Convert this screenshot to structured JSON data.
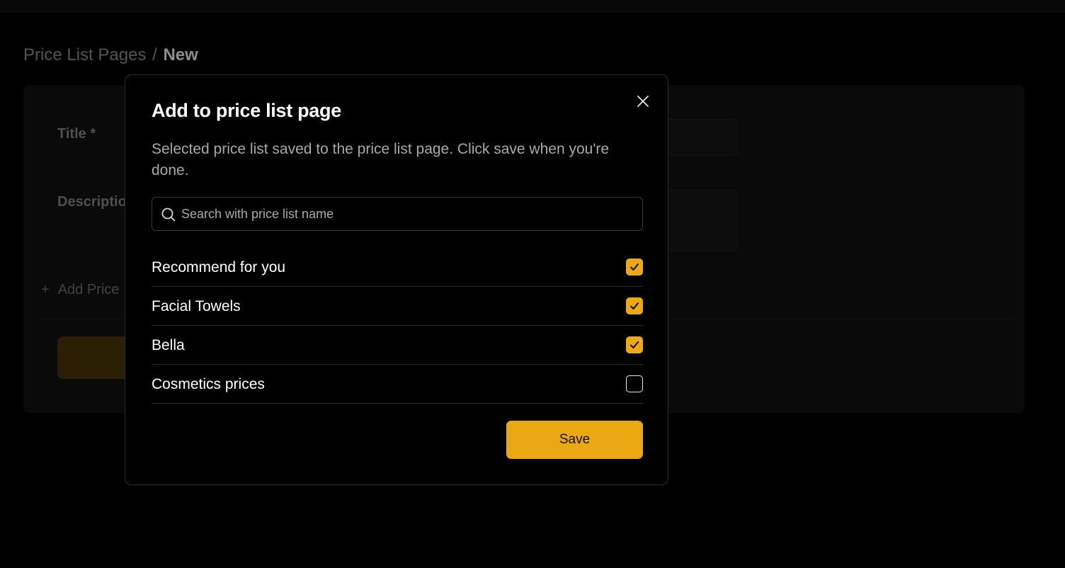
{
  "breadcrumb": {
    "parent": "Price List Pages",
    "separator": "/",
    "current": "New"
  },
  "background_form": {
    "title_label": "Title",
    "title_required_marker": "*",
    "description_label": "Descriptio",
    "add_label": "Add Price",
    "add_icon": "plus-icon"
  },
  "dialog": {
    "title": "Add to price list page",
    "description": "Selected price list saved to the price list page. Click save when you're done.",
    "close_icon": "close-icon",
    "search": {
      "placeholder": "Search with price list name",
      "value": "",
      "icon": "search-icon"
    },
    "items": [
      {
        "label": "Recommend for you",
        "checked": true
      },
      {
        "label": "Facial Towels",
        "checked": true
      },
      {
        "label": "Bella",
        "checked": true
      },
      {
        "label": "Cosmetics prices",
        "checked": false
      }
    ],
    "save_label": "Save"
  },
  "colors": {
    "accent": "#eaa912",
    "background": "#000000",
    "text": "#ffffff",
    "muted": "#a8a8a8"
  }
}
